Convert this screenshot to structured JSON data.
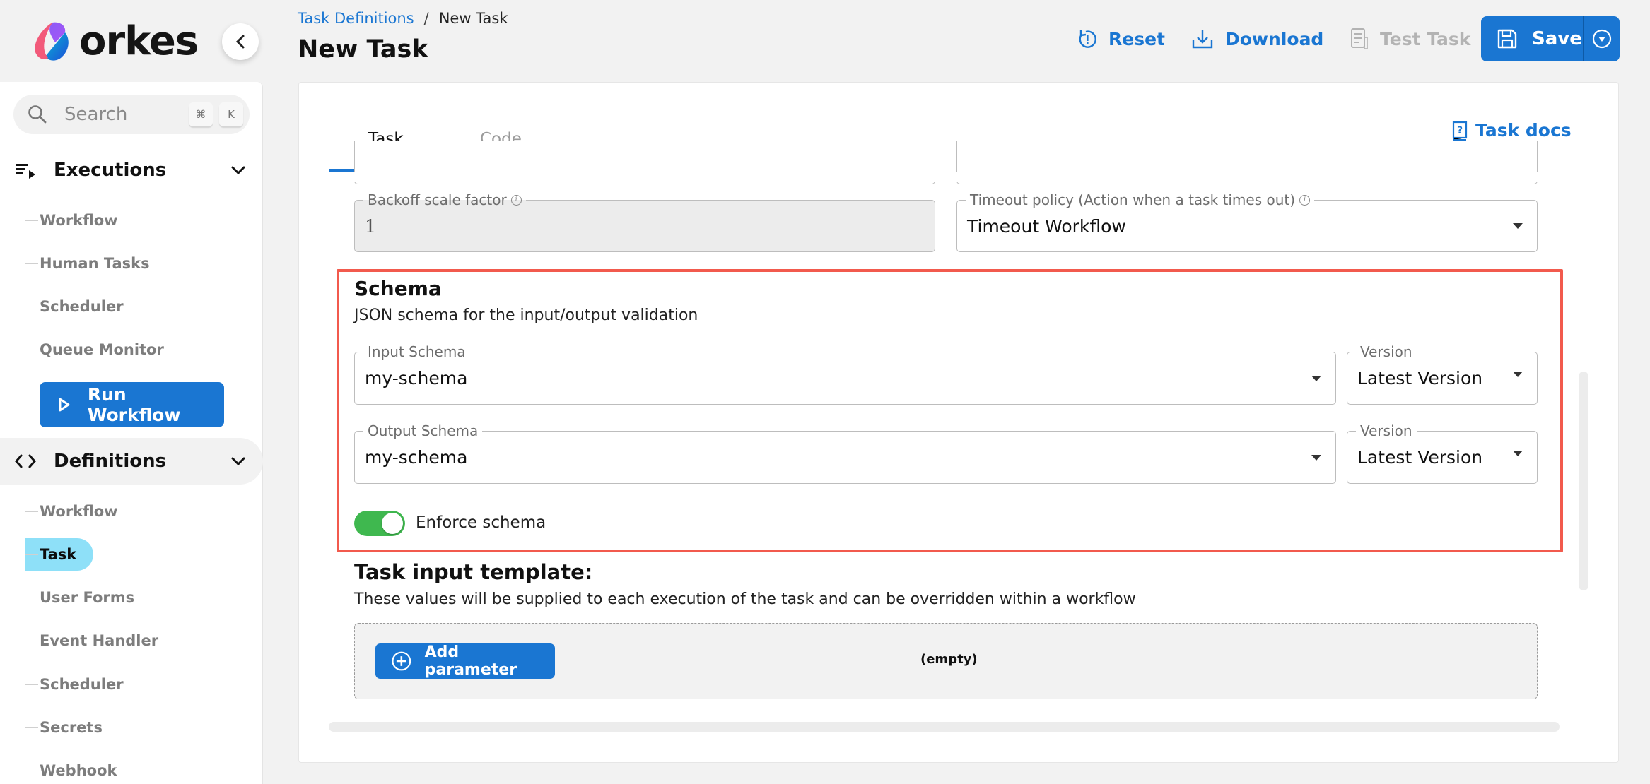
{
  "brand": {
    "name": "orkes"
  },
  "sidebar": {
    "search": {
      "placeholder": "Search",
      "shortcut_mod": "⌘",
      "shortcut_key": "K"
    },
    "executions": {
      "label": "Executions",
      "items": [
        {
          "label": "Workflow"
        },
        {
          "label": "Human Tasks"
        },
        {
          "label": "Scheduler"
        },
        {
          "label": "Queue Monitor"
        }
      ]
    },
    "run_workflow_label": "Run Workflow",
    "definitions": {
      "label": "Definitions",
      "items": [
        {
          "label": "Workflow",
          "active": false
        },
        {
          "label": "Task",
          "active": true
        },
        {
          "label": "User Forms",
          "active": false
        },
        {
          "label": "Event Handler",
          "active": false
        },
        {
          "label": "Scheduler",
          "active": false
        },
        {
          "label": "Secrets",
          "active": false
        },
        {
          "label": "Webhook",
          "active": false
        }
      ]
    }
  },
  "header": {
    "breadcrumb": {
      "parent": "Task Definitions",
      "separator": "/",
      "current": "New Task"
    },
    "title": "New Task",
    "actions": {
      "reset": "Reset",
      "download": "Download",
      "test_task": "Test Task",
      "save": "Save"
    }
  },
  "tabs": [
    {
      "label": "Task",
      "active": true
    },
    {
      "label": "Code",
      "active": false
    }
  ],
  "task_docs_label": "Task docs",
  "fields": {
    "backoff_scale_factor": {
      "label": "Backoff scale factor",
      "value": "1",
      "disabled": true
    },
    "timeout_policy": {
      "label": "Timeout policy (Action when a task times out)",
      "value": "Timeout Workflow"
    }
  },
  "schema": {
    "title": "Schema",
    "subtitle": "JSON schema for the input/output validation",
    "input": {
      "label": "Input Schema",
      "value": "my-schema",
      "version_label": "Version",
      "version_value": "Latest Version"
    },
    "output": {
      "label": "Output Schema",
      "value": "my-schema",
      "version_label": "Version",
      "version_value": "Latest Version"
    },
    "enforce": {
      "label": "Enforce schema",
      "enabled": true
    }
  },
  "input_template": {
    "title": "Task input template:",
    "description": "These values will be supplied to each execution of the task and can be overridden within a workflow",
    "add_parameter_label": "Add parameter",
    "empty_label": "(empty)"
  },
  "colors": {
    "primary": "#1a76d2",
    "highlight_border": "#f25a4d",
    "toggle_on": "#3fb84f",
    "active_nav": "#8ee0f8"
  }
}
